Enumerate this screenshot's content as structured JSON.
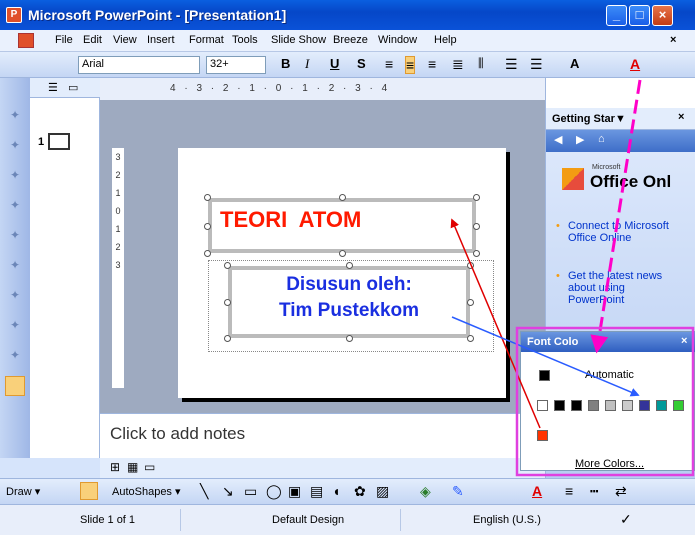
{
  "window": {
    "title": "Microsoft PowerPoint - [Presentation1]",
    "app_icon": "P",
    "min": "_",
    "max": "□",
    "close": "×"
  },
  "menu": [
    "File",
    "Edit",
    "View",
    "Insert",
    "Format",
    "Tools",
    "Slide Show",
    "Breeze",
    "Window",
    "Help"
  ],
  "menu_close": "×",
  "toolbar": {
    "font": "Arial",
    "size": "32+",
    "bold": "B",
    "italic": "I",
    "underline": "U",
    "shadow": "S",
    "grow_font": "A"
  },
  "thumbnails": {
    "slide_number": "1"
  },
  "ruler": {
    "horizontal": "4 · 3 · 2 · 1 · 0 · 1 · 2 · 3 · 4",
    "vertical": "3 · 2 · 1 · 0 · 1 · 2 · 3"
  },
  "slide": {
    "title": "TEORI  ATOM",
    "subtitle_line1": "Disusun oleh:",
    "subtitle_line2": "Tim Pustekkom",
    "title_color": "#ff1a00",
    "subtitle_color": "#1a2fe0"
  },
  "notes": {
    "placeholder": "Click to add notes"
  },
  "task_pane": {
    "title": "Getting Star▼",
    "close": "×",
    "logo_text": "Office Onl",
    "logo_superscript": "Microsoft",
    "links": [
      "Connect to Microsoft Office Online",
      "Get the latest news about using PowerPoint"
    ]
  },
  "font_color_popup": {
    "title": "Font Colo",
    "close": "×",
    "automatic": "Automatic",
    "more_colors": "More Colors...",
    "scheme_colors": [
      "#ffffff",
      "#000000",
      "#000000",
      "#808080",
      "#c0c0c0",
      "#cccccc",
      "#333399",
      "#009999",
      "#33cc33"
    ],
    "recent_color": "#ff3300"
  },
  "draw_toolbar": {
    "draw": "Draw ▾",
    "autoshapes": "AutoShapes ▾"
  },
  "status": {
    "slide": "Slide 1 of 1",
    "design": "Default Design",
    "language": "English (U.S.)"
  },
  "annotation_colors": {
    "pink": "#ff00c8",
    "red": "#e00000",
    "blue": "#2a5cff",
    "pane_border": "#e040e0"
  }
}
